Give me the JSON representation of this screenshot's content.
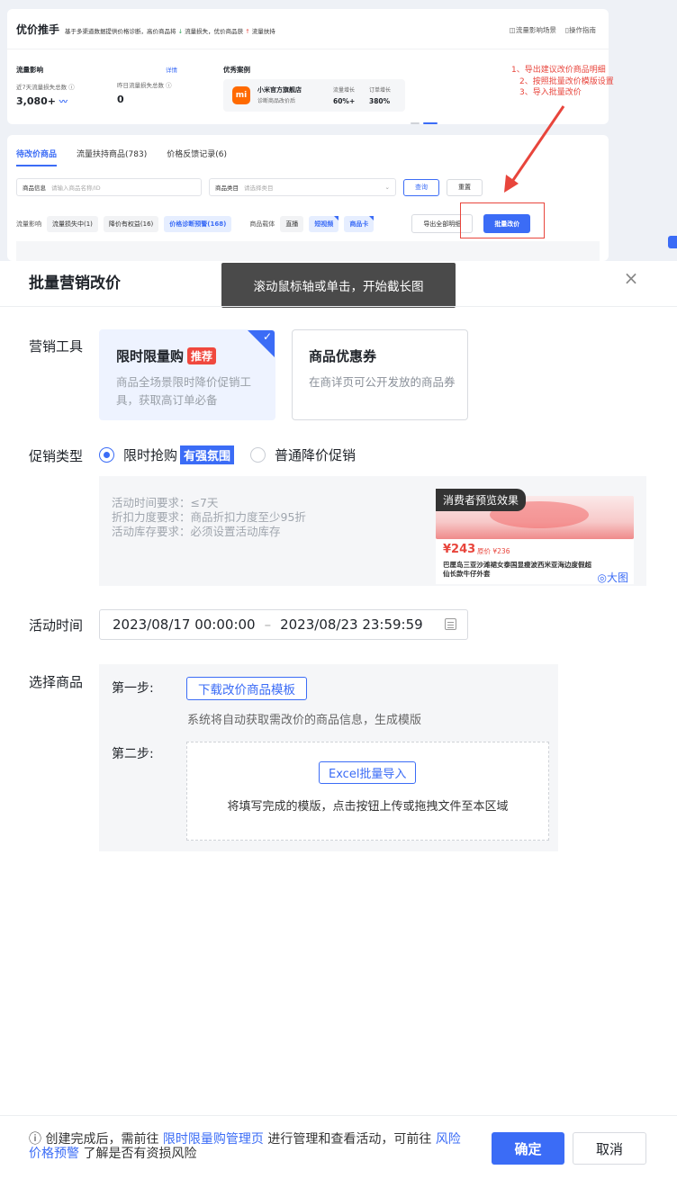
{
  "background": {
    "header": {
      "title": "优价推手",
      "desc_a": "基于多渠道数据提供价格诊断，高价商品将",
      "desc_down_arrow": "↓",
      "desc_b": "流量损失，优价商品获",
      "desc_up_arrow": "↑",
      "desc_c": "流量扶持",
      "link_scenes": "流量影响场景",
      "link_guide": "操作指南"
    },
    "metrics": {
      "title": "流量影响",
      "detail_link": "详情",
      "loss_7d_label": "近7天流量损失总数 ⓘ",
      "loss_7d_value": "3,080+",
      "loss_yday_label": "昨日流量损失总数 ⓘ",
      "loss_yday_value": "0"
    },
    "case": {
      "title": "优秀案例",
      "logo": "mi",
      "shop": "小米官方旗舰店",
      "subtitle": "诊断商品改价后",
      "traffic_label": "流量增长",
      "traffic_value": "60%+",
      "order_label": "订单增长",
      "order_value": "380%"
    },
    "tabs": [
      "待改价商品",
      "流量扶持商品(783)",
      "价格反馈记录(6)"
    ],
    "filters": {
      "product_label": "商品信息",
      "product_placeholder": "请输入商品名称/ID",
      "category_label": "商品类目",
      "category_placeholder": "请选择类目",
      "query": "查询",
      "reset": "重置"
    },
    "tag_row": {
      "impact_label": "流量影响",
      "tags": [
        "流量损失中(1)",
        "降价有权益(16)",
        "价格诊断预警(168)"
      ],
      "carrier_label": "商品载体",
      "carriers": [
        "直播",
        "短视频",
        "商品卡"
      ],
      "export": "导出全部明细",
      "batch": "批量改价"
    },
    "annotations": [
      "1、导出建议改价商品明细",
      "2、按照批量改价模版设置",
      "3、导入批量改价"
    ],
    "colors": {
      "annotation": "#e8453c",
      "accent": "#3b6cf6"
    }
  },
  "modal": {
    "title": "批量营销改价",
    "tooltip": "滚动鼠标轴或单击，开始截长图",
    "close_icon": "×",
    "tool_label": "营销工具",
    "tools": [
      {
        "name": "限时限量购",
        "badge": "推荐",
        "desc": "商品全场景限时降价促销工具，获取高订单必备"
      },
      {
        "name": "商品优惠券",
        "desc": "在商详页可公开发放的商品券"
      }
    ],
    "promo_label": "促销类型",
    "promo_options": {
      "flash": "限时抢购",
      "flash_badge": "有强氛围",
      "normal": "普通降价促销"
    },
    "requirements": [
      "活动时间要求：≤7天",
      "折扣力度要求：商品折扣力度至少95折",
      "活动库存要求：必须设置活动库存"
    ],
    "preview": {
      "label": "消费者预览效果",
      "price": "¥243",
      "old_price": "原价 ¥236",
      "name": "巴厘岛三亚沙滩裙女泰国显瘦波西米亚海边度假超仙长款牛仔外套",
      "big_link": "◎大图"
    },
    "time_label": "活动时间",
    "time_start": "2023/08/17 00:00:00",
    "time_sep": "–",
    "time_end": "2023/08/23 23:59:59",
    "goods_label": "选择商品",
    "step1_label": "第一步:",
    "download_btn": "下载改价商品模板",
    "step1_desc": "系统将自动获取需改价的商品信息，生成模版",
    "step2_label": "第二步:",
    "excel_btn": "Excel批量导入",
    "step2_desc": "将填写完成的模版，点击按钮上传或拖拽文件至本区域",
    "footer": {
      "note_a": "ⓘ 创建完成后，需前往",
      "link_a": "限时限量购管理页",
      "note_b": "进行管理和查看活动，可前往",
      "link_b": "风险价格预警",
      "note_c": "了解是否有资损风险",
      "confirm": "确定",
      "cancel": "取消"
    }
  }
}
